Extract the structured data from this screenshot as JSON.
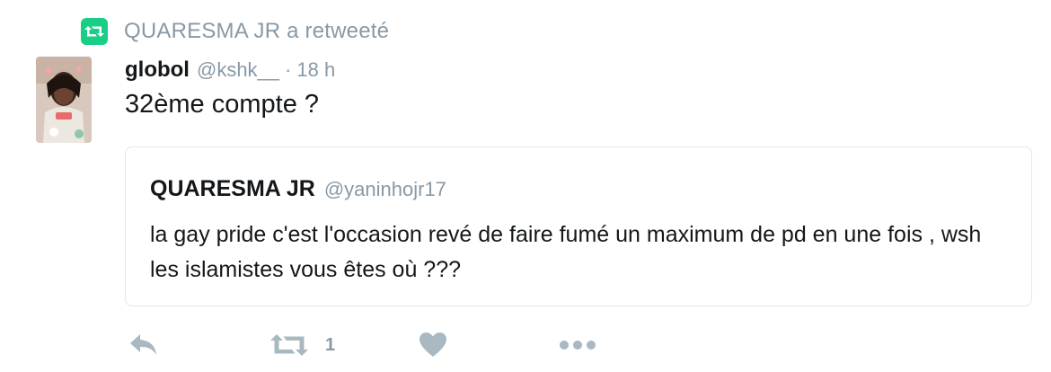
{
  "retweet_context": {
    "text": "QUARESMA JR a retweeté",
    "icon": "retweet-icon",
    "color": "#19cf86"
  },
  "tweet": {
    "author": {
      "name": "globol",
      "handle": "@kshk__"
    },
    "separator": "·",
    "time": "18 h",
    "text": "32ème compte ?"
  },
  "quoted_tweet": {
    "author": {
      "name": "QUARESMA JR",
      "handle": "@yaninhojr17"
    },
    "text": "la gay pride c'est l'occasion revé de faire fumé un maximum de pd en une fois , wsh les islamistes vous êtes où ???"
  },
  "actions": {
    "reply_icon": "reply-icon",
    "retweet_icon": "retweet-icon",
    "retweet_count": "1",
    "like_icon": "heart-icon",
    "more_icon": "more-dots-icon"
  },
  "colors": {
    "text": "#14171a",
    "muted": "#8899a6",
    "icon": "#aab8c2",
    "border": "#e1e8ed"
  }
}
